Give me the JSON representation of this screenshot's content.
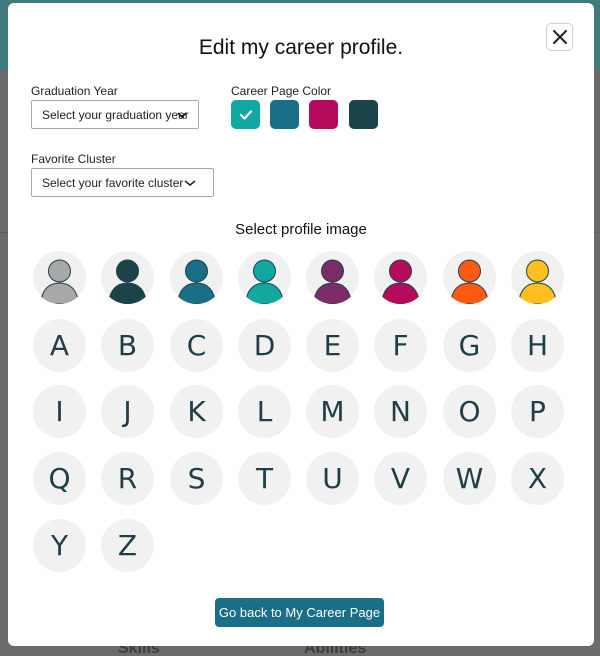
{
  "modal": {
    "title": "Edit my career profile.",
    "graduation": {
      "label": "Graduation Year",
      "value": "Select your graduation year"
    },
    "cluster": {
      "label": "Favorite Cluster",
      "value": "Select your favorite cluster"
    },
    "color": {
      "label": "Career Page Color",
      "options": [
        {
          "color": "#10a8a0",
          "selected": true
        },
        {
          "color": "#1a6e85",
          "selected": false
        },
        {
          "color": "#b60b5d",
          "selected": false
        },
        {
          "color": "#1d434a",
          "selected": false
        }
      ]
    },
    "profile_image": {
      "heading": "Select profile image",
      "person_avatars": [
        {
          "head": "#a8a8a8",
          "body": "#a8a8a8"
        },
        {
          "head": "#1d434a",
          "body": "#1d434a"
        },
        {
          "head": "#1a6e85",
          "body": "#1a6e85"
        },
        {
          "head": "#10a8a0",
          "body": "#10a8a0"
        },
        {
          "head": "#7a2b68",
          "body": "#7a2b68"
        },
        {
          "head": "#b60b5d",
          "body": "#b60b5d"
        },
        {
          "head": "#ff5a13",
          "body": "#ff5a13"
        },
        {
          "head": "#ffc01f",
          "body": "#ffc01f"
        }
      ],
      "letters": [
        "A",
        "B",
        "C",
        "D",
        "E",
        "F",
        "G",
        "H",
        "I",
        "J",
        "K",
        "L",
        "M",
        "N",
        "O",
        "P",
        "Q",
        "R",
        "S",
        "T",
        "U",
        "V",
        "W",
        "X",
        "Y",
        "Z"
      ]
    },
    "back_button": "Go back to My Career Page"
  },
  "background": {
    "tabs": [
      "Skills",
      "Abilities"
    ]
  }
}
